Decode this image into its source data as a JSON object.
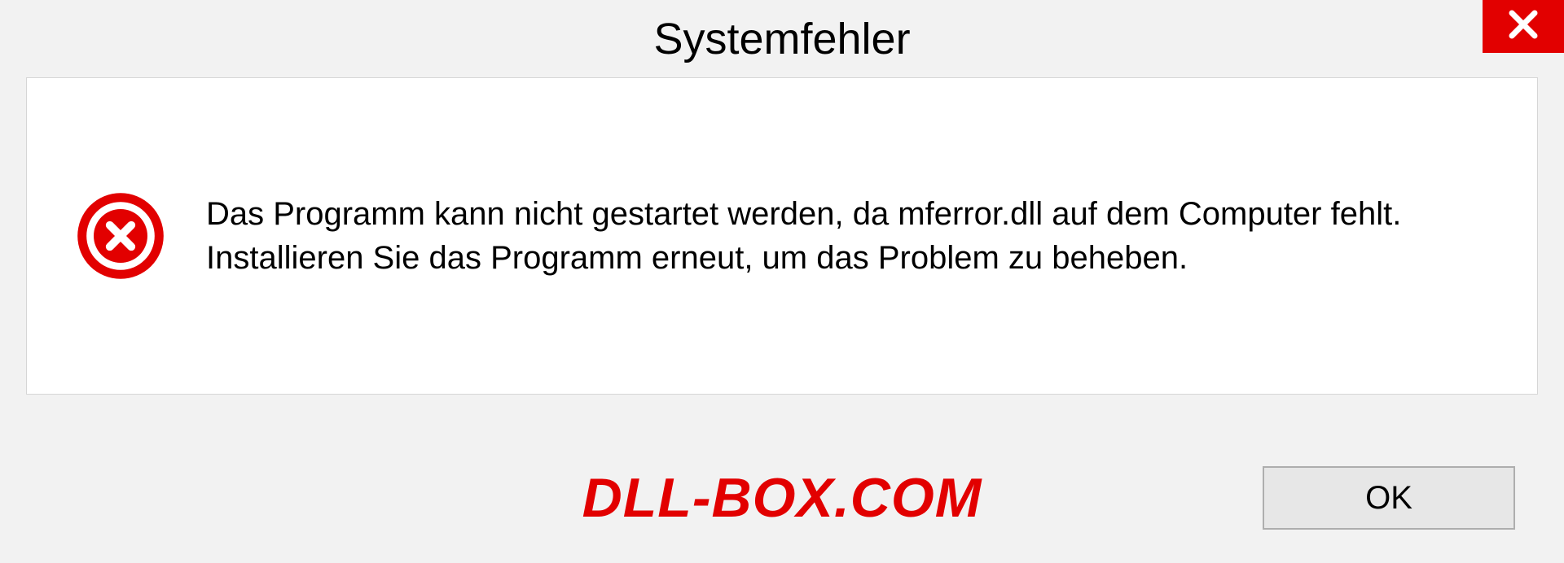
{
  "dialog": {
    "title": "Systemfehler",
    "message": "Das Programm kann nicht gestartet werden, da mferror.dll auf dem Computer fehlt. Installieren Sie das Programm erneut, um das Problem zu beheben.",
    "ok_label": "OK"
  },
  "watermark": "DLL-BOX.COM"
}
